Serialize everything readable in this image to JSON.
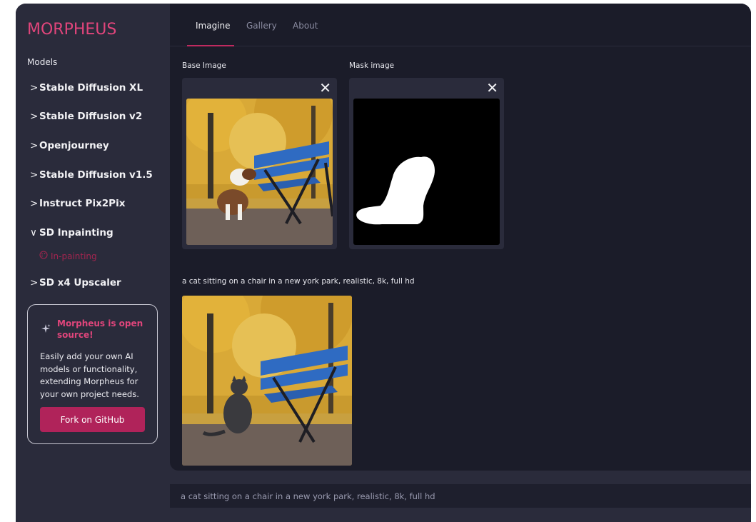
{
  "app": {
    "logo": "MORPHEUS"
  },
  "sidebar": {
    "models_title": "Models",
    "items": [
      {
        "label": "Stable Diffusion XL",
        "chevron": ">"
      },
      {
        "label": "Stable Diffusion v2",
        "chevron": ">"
      },
      {
        "label": "Openjourney",
        "chevron": ">"
      },
      {
        "label": "Stable Diffusion v1.5",
        "chevron": ">"
      },
      {
        "label": "Instruct Pix2Pix",
        "chevron": ">"
      },
      {
        "label": "SD Inpainting",
        "chevron": "∨",
        "expanded": true
      },
      {
        "label": "SD x4 Upscaler",
        "chevron": ">"
      }
    ],
    "subitem": {
      "label": "In-painting",
      "icon": "palette-icon"
    },
    "promo": {
      "title": "Morpheus is open source!",
      "body": "Easily add your own AI models or functionality, extending Morpheus for your own project needs.",
      "button": "Fork on GitHub",
      "icon": "sparkles-icon"
    }
  },
  "tabs": [
    {
      "label": "Imagine",
      "active": true
    },
    {
      "label": "Gallery",
      "active": false
    },
    {
      "label": "About",
      "active": false
    }
  ],
  "main": {
    "base_image_label": "Base Image",
    "mask_image_label": "Mask image",
    "result_caption": "a cat sitting on a chair in a new york park, realistic, 8k, full hd"
  },
  "prompt": {
    "text": "a cat sitting on a chair in a new york park, realistic, 8k, full hd"
  },
  "colors": {
    "accent": "#e0457b",
    "button": "#b0235a",
    "sidebar_bg": "#2a2b3b",
    "main_bg": "#1b1c29"
  }
}
